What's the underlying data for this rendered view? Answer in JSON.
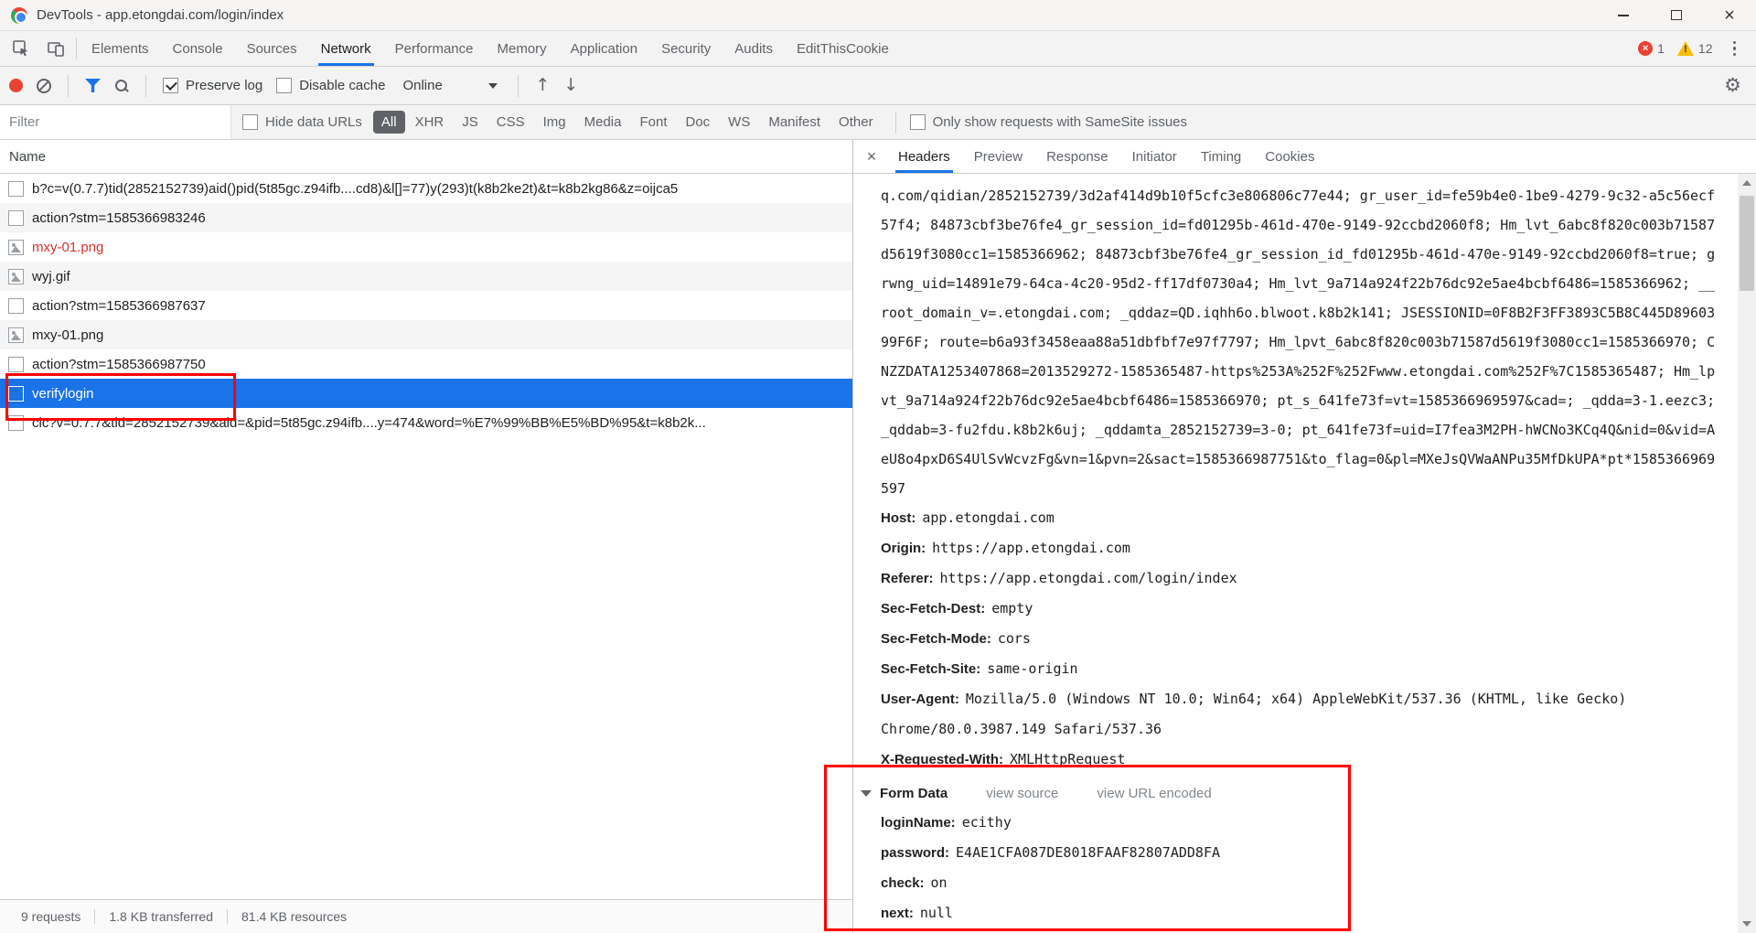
{
  "titlebar": {
    "title": "DevTools - app.etongdai.com/login/index"
  },
  "devtools_tabs": {
    "tabs": [
      {
        "label": "Elements"
      },
      {
        "label": "Console"
      },
      {
        "label": "Sources"
      },
      {
        "label": "Network"
      },
      {
        "label": "Performance"
      },
      {
        "label": "Memory"
      },
      {
        "label": "Application"
      },
      {
        "label": "Security"
      },
      {
        "label": "Audits"
      },
      {
        "label": "EditThisCookie"
      }
    ],
    "active_tab": "Network",
    "error_count": "1",
    "warning_count": "12"
  },
  "network_toolbar": {
    "preserve_log_label": "Preserve log",
    "preserve_log_checked": true,
    "disable_cache_label": "Disable cache",
    "disable_cache_checked": false,
    "throttling_value": "Online"
  },
  "filter_bar": {
    "filter_placeholder": "Filter",
    "filter_value": "",
    "hide_data_urls_label": "Hide data URLs",
    "hide_data_urls_checked": false,
    "type_filters": [
      {
        "label": "All",
        "active": true
      },
      {
        "label": "XHR",
        "active": false
      },
      {
        "label": "JS",
        "active": false
      },
      {
        "label": "CSS",
        "active": false
      },
      {
        "label": "Img",
        "active": false
      },
      {
        "label": "Media",
        "active": false
      },
      {
        "label": "Font",
        "active": false
      },
      {
        "label": "Doc",
        "active": false
      },
      {
        "label": "WS",
        "active": false
      },
      {
        "label": "Manifest",
        "active": false
      },
      {
        "label": "Other",
        "active": false
      }
    ],
    "samesite_label": "Only show requests with SameSite issues",
    "samesite_checked": false
  },
  "request_list": {
    "name_column_header": "Name",
    "rows": [
      {
        "name": "b?c=v(0.7.7)tid(2852152739)aid()pid(5t85gc.z94ifb....cd8)&l[]=77)y(293)t(k8b2ke2t)&t=k8b2kg86&z=oijca5",
        "icon": "document",
        "status": "normal"
      },
      {
        "name": "action?stm=1585366983246",
        "icon": "document",
        "status": "normal"
      },
      {
        "name": "mxy-01.png",
        "icon": "image",
        "status": "error"
      },
      {
        "name": "wyj.gif",
        "icon": "image",
        "status": "normal"
      },
      {
        "name": "action?stm=1585366987637",
        "icon": "document",
        "status": "normal"
      },
      {
        "name": "mxy-01.png",
        "icon": "image",
        "status": "normal"
      },
      {
        "name": "action?stm=1585366987750",
        "icon": "document",
        "status": "normal"
      },
      {
        "name": "verifylogin",
        "icon": "document",
        "status": "selected"
      },
      {
        "name": "clc?v=0.7.7&tid=2852152739&aid=&pid=5t85gc.z94ifb....y=474&word=%E7%99%BB%E5%BD%95&t=k8b2k...",
        "icon": "document",
        "status": "normal"
      }
    ]
  },
  "detail_pane": {
    "tabs": [
      {
        "label": "Headers"
      },
      {
        "label": "Preview"
      },
      {
        "label": "Response"
      },
      {
        "label": "Initiator"
      },
      {
        "label": "Timing"
      },
      {
        "label": "Cookies"
      }
    ],
    "active_tab": "Headers",
    "cookie_overflow_text": "q.com/qidian/2852152739/3d2af414d9b10f5cfc3e806806c77e44; gr_user_id=fe59b4e0-1be9-4279-9c32-a5c56ecf57f4; 84873cbf3be76fe4_gr_session_id=fd01295b-461d-470e-9149-92ccbd2060f8; Hm_lvt_6abc8f820c003b71587d5619f3080cc1=1585366962; 84873cbf3be76fe4_gr_session_id_fd01295b-461d-470e-9149-92ccbd2060f8=true; grwng_uid=14891e79-64ca-4c20-95d2-ff17df0730a4; Hm_lvt_9a714a924f22b76dc92e5ae4bcbf6486=1585366962; __root_domain_v=.etongdai.com; _qddaz=QD.iqhh6o.blwoot.k8b2k141; JSESSIONID=0F8B2F3FF3893C5B8C445D8960399F6F; route=b6a93f3458eaa88a51dbfbf7e97f7797; Hm_lpvt_6abc8f820c003b71587d5619f3080cc1=1585366970; CNZZDATA1253407868=2013529272-1585365487-https%253A%252F%252Fwww.etongdai.com%252F%7C1585365487; Hm_lpvt_9a714a924f22b76dc92e5ae4bcbf6486=1585366970; pt_s_641fe73f=vt=1585366969597&cad=; _qdda=3-1.eezc3; _qddab=3-fu2fdu.k8b2k6uj; _qddamta_2852152739=3-0; pt_641fe73f=uid=I7fea3M2PH-hWCNo3KCq4Q&nid=0&vid=AeU8o4pxD6S4UlSvWcvzFg&vn=1&pvn=2&sact=1585366987751&to_flag=0&pl=MXeJsQVWaANPu35MfDkUPA*pt*1585366969597",
    "request_headers": [
      {
        "name": "Host:",
        "value": "app.etongdai.com"
      },
      {
        "name": "Origin:",
        "value": "https://app.etongdai.com"
      },
      {
        "name": "Referer:",
        "value": "https://app.etongdai.com/login/index"
      },
      {
        "name": "Sec-Fetch-Dest:",
        "value": "empty"
      },
      {
        "name": "Sec-Fetch-Mode:",
        "value": "cors"
      },
      {
        "name": "Sec-Fetch-Site:",
        "value": "same-origin"
      },
      {
        "name": "User-Agent:",
        "value": "Mozilla/5.0 (Windows NT 10.0; Win64; x64) AppleWebKit/537.36 (KHTML, like Gecko) Chrome/80.0.3987.149 Safari/537.36"
      },
      {
        "name": "X-Requested-With:",
        "value": "XMLHttpRequest"
      }
    ],
    "form_data": {
      "section_title": "Form Data",
      "view_source_label": "view source",
      "view_url_encoded_label": "view URL encoded",
      "params": [
        {
          "key": "loginName:",
          "value": "ecithy"
        },
        {
          "key": "password:",
          "value": "E4AE1CFA087DE8018FAAF82807ADD8FA"
        },
        {
          "key": "check:",
          "value": "on"
        },
        {
          "key": "next:",
          "value": "null"
        }
      ]
    }
  },
  "status_bar": {
    "requests_count": "9 requests",
    "transferred": "1.8 KB transferred",
    "resources": "81.4 KB resources"
  },
  "colors": {
    "selection_blue": "#1a73e8",
    "error_text_red": "#d93025",
    "annotation_red": "#ff0000",
    "record_red": "#ea4335",
    "warning_yellow": "#fbbc04",
    "active_filter_pill_bg": "#5f6368",
    "toolbar_bg": "#f3f3f3"
  },
  "icons": {
    "record": "filled-circle",
    "clear": "circle-slash",
    "filter": "funnel",
    "search": "magnifier",
    "settings": "gear",
    "more": "vertical-dots",
    "close": "x",
    "import_har": "up-arrow",
    "export_har": "down-arrow",
    "import_glyph": "↑",
    "export_glyph": "↓",
    "gear_glyph": "⚙"
  }
}
